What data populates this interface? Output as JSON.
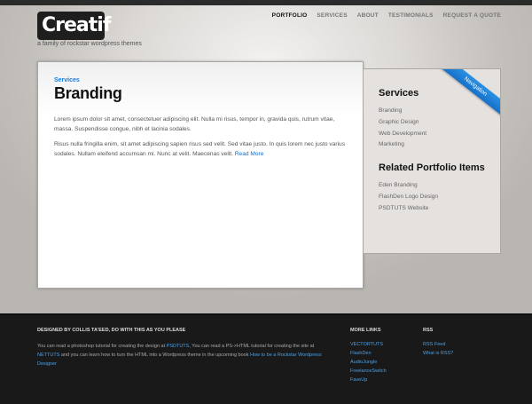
{
  "header": {
    "logo": "Creatif",
    "tagline": "a family of rockstar wordpress themes",
    "nav": [
      "PORTFOLIO",
      "SERVICES",
      "ABOUT",
      "TESTIMONIALS",
      "REQUEST A QUOTE"
    ]
  },
  "main": {
    "breadcrumb": "Services",
    "title": "Branding",
    "paragraph1": "Lorem ipsum dolor sit amet, consectetuer adipiscing elit. Nulla mi risus, tempor in, gravida quis, rutrum vitae, massa. Suspendisse congue, nibh et lacinia sodales.",
    "paragraph2": "Risus nulla fringilla enim, sit amet adipiscing sapien risus sed velit. Sed vitae justo. In quis lorem nec justo varius sodales. Nullam eleifend accumsan mi. Nunc at velit. Maecenas velit.",
    "read_more": "Read More"
  },
  "sidebar": {
    "ribbon": "Navigation",
    "services_heading": "Services",
    "services": [
      "Branding",
      "Graphic Design",
      "Web Development",
      "Marketing"
    ],
    "related_heading": "Related Portfolio Items",
    "related": [
      "Eden Branding",
      "FlashDen Logo Design",
      "PSDTUTS Website"
    ]
  },
  "footer": {
    "about_heading": "DESIGNED BY COLLIS TA'EED, DO WITH THIS AS YOU PLEASE",
    "about_t1": "You can read a photoshop tutorial for creating the design at ",
    "about_l1": "PSDTUTS",
    "about_t2": ", You can read a PS->HTML tutorial for creating the site at ",
    "about_l2": "NETTUTS",
    "about_t3": " and you can learn how to turn the HTML into a Wordpress theme in the upcoming book ",
    "about_l3": "How to be a Rockstar Wordpress Designer",
    "more_links_heading": "MORE LINKS",
    "more_links": [
      "VECTORTUTS",
      "FlashDen",
      "AudioJungle",
      "FreelanceSwitch",
      "FaveUp"
    ],
    "rss_heading": "RSS",
    "rss_links": [
      "RSS Feed",
      "What is RSS?"
    ]
  }
}
